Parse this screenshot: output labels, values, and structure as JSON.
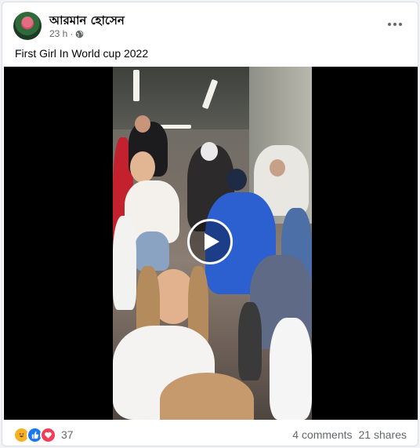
{
  "post": {
    "author": "আরমান হোসেন",
    "time": "23 h",
    "separator": "·",
    "caption": "First Girl In World cup 2022"
  },
  "video": {
    "controls": [
      "play-icon"
    ]
  },
  "footer": {
    "reaction_icons": [
      "haha-icon",
      "like-icon",
      "love-icon"
    ],
    "reaction_count": "37",
    "comments": "4 comments",
    "shares": "21 shares"
  },
  "colors": {
    "like": "#1877f2",
    "love": "#f33e58",
    "haha": "#f7b125",
    "secondary_text": "#65676b"
  }
}
